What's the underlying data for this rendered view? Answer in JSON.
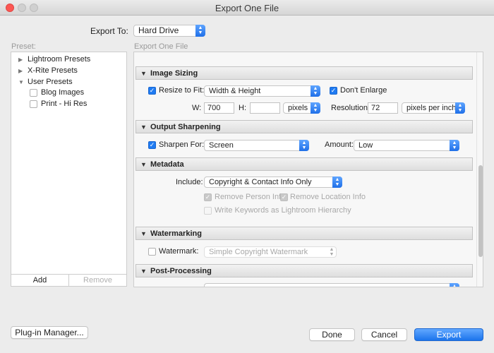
{
  "window": {
    "title": "Export One File"
  },
  "export_to": {
    "label": "Export To:",
    "value": "Hard Drive"
  },
  "presets": {
    "header": "Preset:",
    "items": [
      {
        "label": "Lightroom Presets",
        "expanded": false
      },
      {
        "label": "X-Rite Presets",
        "expanded": false
      },
      {
        "label": "User Presets",
        "expanded": true
      }
    ],
    "user_presets": [
      "Blog Images",
      "Print - Hi Res"
    ],
    "add_label": "Add",
    "remove_label": "Remove"
  },
  "main": {
    "header": "Export One File",
    "image_sizing": {
      "title": "Image Sizing",
      "resize_label": "Resize to Fit:",
      "resize_checked": true,
      "resize_mode": "Width & Height",
      "dont_enlarge_label": "Don't Enlarge",
      "dont_enlarge_checked": true,
      "w_label": "W:",
      "w_value": "700",
      "h_label": "H:",
      "h_value": "",
      "unit": "pixels",
      "resolution_label": "Resolution:",
      "resolution_value": "72",
      "resolution_unit": "pixels per inch"
    },
    "output_sharpening": {
      "title": "Output Sharpening",
      "sharpen_label": "Sharpen For:",
      "sharpen_checked": true,
      "sharpen_for": "Screen",
      "amount_label": "Amount:",
      "amount": "Low"
    },
    "metadata": {
      "title": "Metadata",
      "include_label": "Include:",
      "include_value": "Copyright & Contact Info Only",
      "remove_person_label": "Remove Person Info",
      "remove_location_label": "Remove Location Info",
      "write_keywords_label": "Write Keywords as Lightroom Hierarchy"
    },
    "watermarking": {
      "title": "Watermarking",
      "watermark_label": "Watermark:",
      "watermark_checked": false,
      "watermark_value": "Simple Copyright Watermark"
    },
    "post_processing": {
      "title": "Post-Processing"
    }
  },
  "buttons": {
    "plugin_manager": "Plug-in Manager...",
    "done": "Done",
    "cancel": "Cancel",
    "export": "Export"
  },
  "colors": {
    "accent": "#1f7bf2",
    "window_bg": "#ececec"
  }
}
